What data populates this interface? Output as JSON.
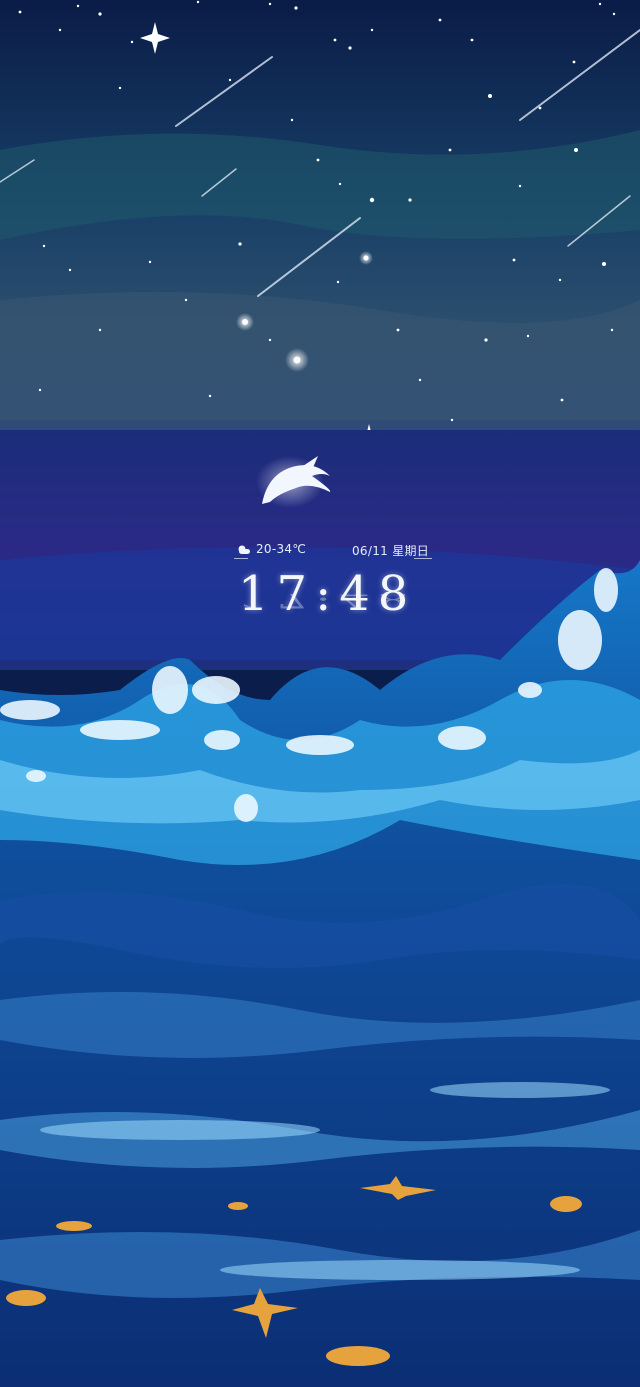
{
  "lockscreen": {
    "weather": {
      "icon": "sun-cloud-icon",
      "temperature_range": "20-34℃"
    },
    "date": "06/11 星期日",
    "time": "17:48"
  },
  "wallpaper": {
    "description_icon": "whale-icon",
    "colors": {
      "sky_top": "#0a1c47",
      "sky_mid": "#1d4a68",
      "horizon": "#3d5a7a",
      "sea_dark": "#1a2a78",
      "wave_light": "#4fc3f7",
      "sea_deep": "#0d3b8a",
      "starfish": "#e6a23c"
    }
  }
}
